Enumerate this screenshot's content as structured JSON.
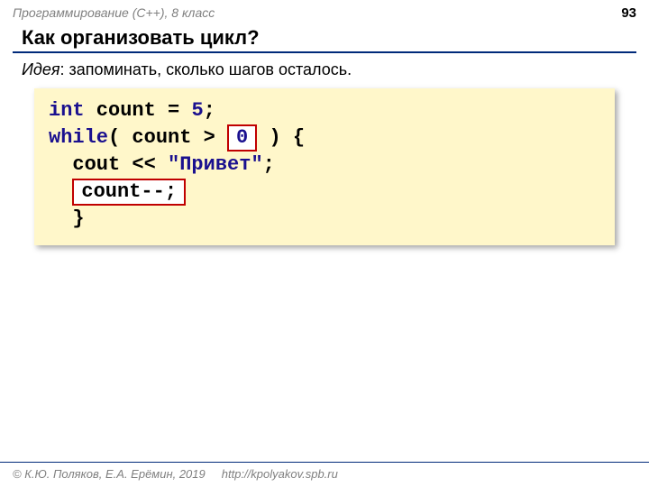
{
  "header": {
    "course": "Программирование (C++), 8 класс",
    "page": "93"
  },
  "title": "Как организовать цикл?",
  "idea": {
    "label": "Идея",
    "text": ": запоминать, сколько шагов осталось."
  },
  "code": {
    "l1_kw": "int",
    "l1_rest": " count = ",
    "l1_num": "5",
    "l1_semi": ";",
    "l2_kw": "while",
    "l2_open": "( count > ",
    "l2_box": "0",
    "l2_close": " ) {",
    "l3_cout": "  cout ",
    "l3_op": "<<",
    "l3_str": " \"Привет\"",
    "l3_semi": ";",
    "l4_indent": "  ",
    "l4_box": "count--;",
    "l5": "  }"
  },
  "footer": {
    "copyright": "© К.Ю. Поляков, Е.А. Ерёмин, 2019",
    "url": "http://kpolyakov.spb.ru"
  }
}
